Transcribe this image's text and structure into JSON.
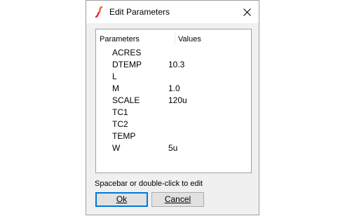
{
  "window": {
    "title": "Edit Parameters"
  },
  "table": {
    "headers": {
      "parameters": "Parameters",
      "values": "Values"
    },
    "rows": [
      {
        "name": "ACRES",
        "value": ""
      },
      {
        "name": "DTEMP",
        "value": "10.3"
      },
      {
        "name": "L",
        "value": ""
      },
      {
        "name": "M",
        "value": "1.0"
      },
      {
        "name": "SCALE",
        "value": "120u"
      },
      {
        "name": "TC1",
        "value": ""
      },
      {
        "name": "TC2",
        "value": ""
      },
      {
        "name": "TEMP",
        "value": ""
      },
      {
        "name": "W",
        "value": "5u"
      }
    ]
  },
  "hint": "Spacebar or double-click to edit",
  "buttons": {
    "ok": "Ok",
    "cancel": "Cancel"
  },
  "icons": {
    "app": "ltspice-app-icon",
    "close": "close-icon"
  },
  "colors": {
    "icon_red": "#e8262b",
    "icon_orange": "#f29a1f",
    "default_button_border": "#0078d7"
  }
}
